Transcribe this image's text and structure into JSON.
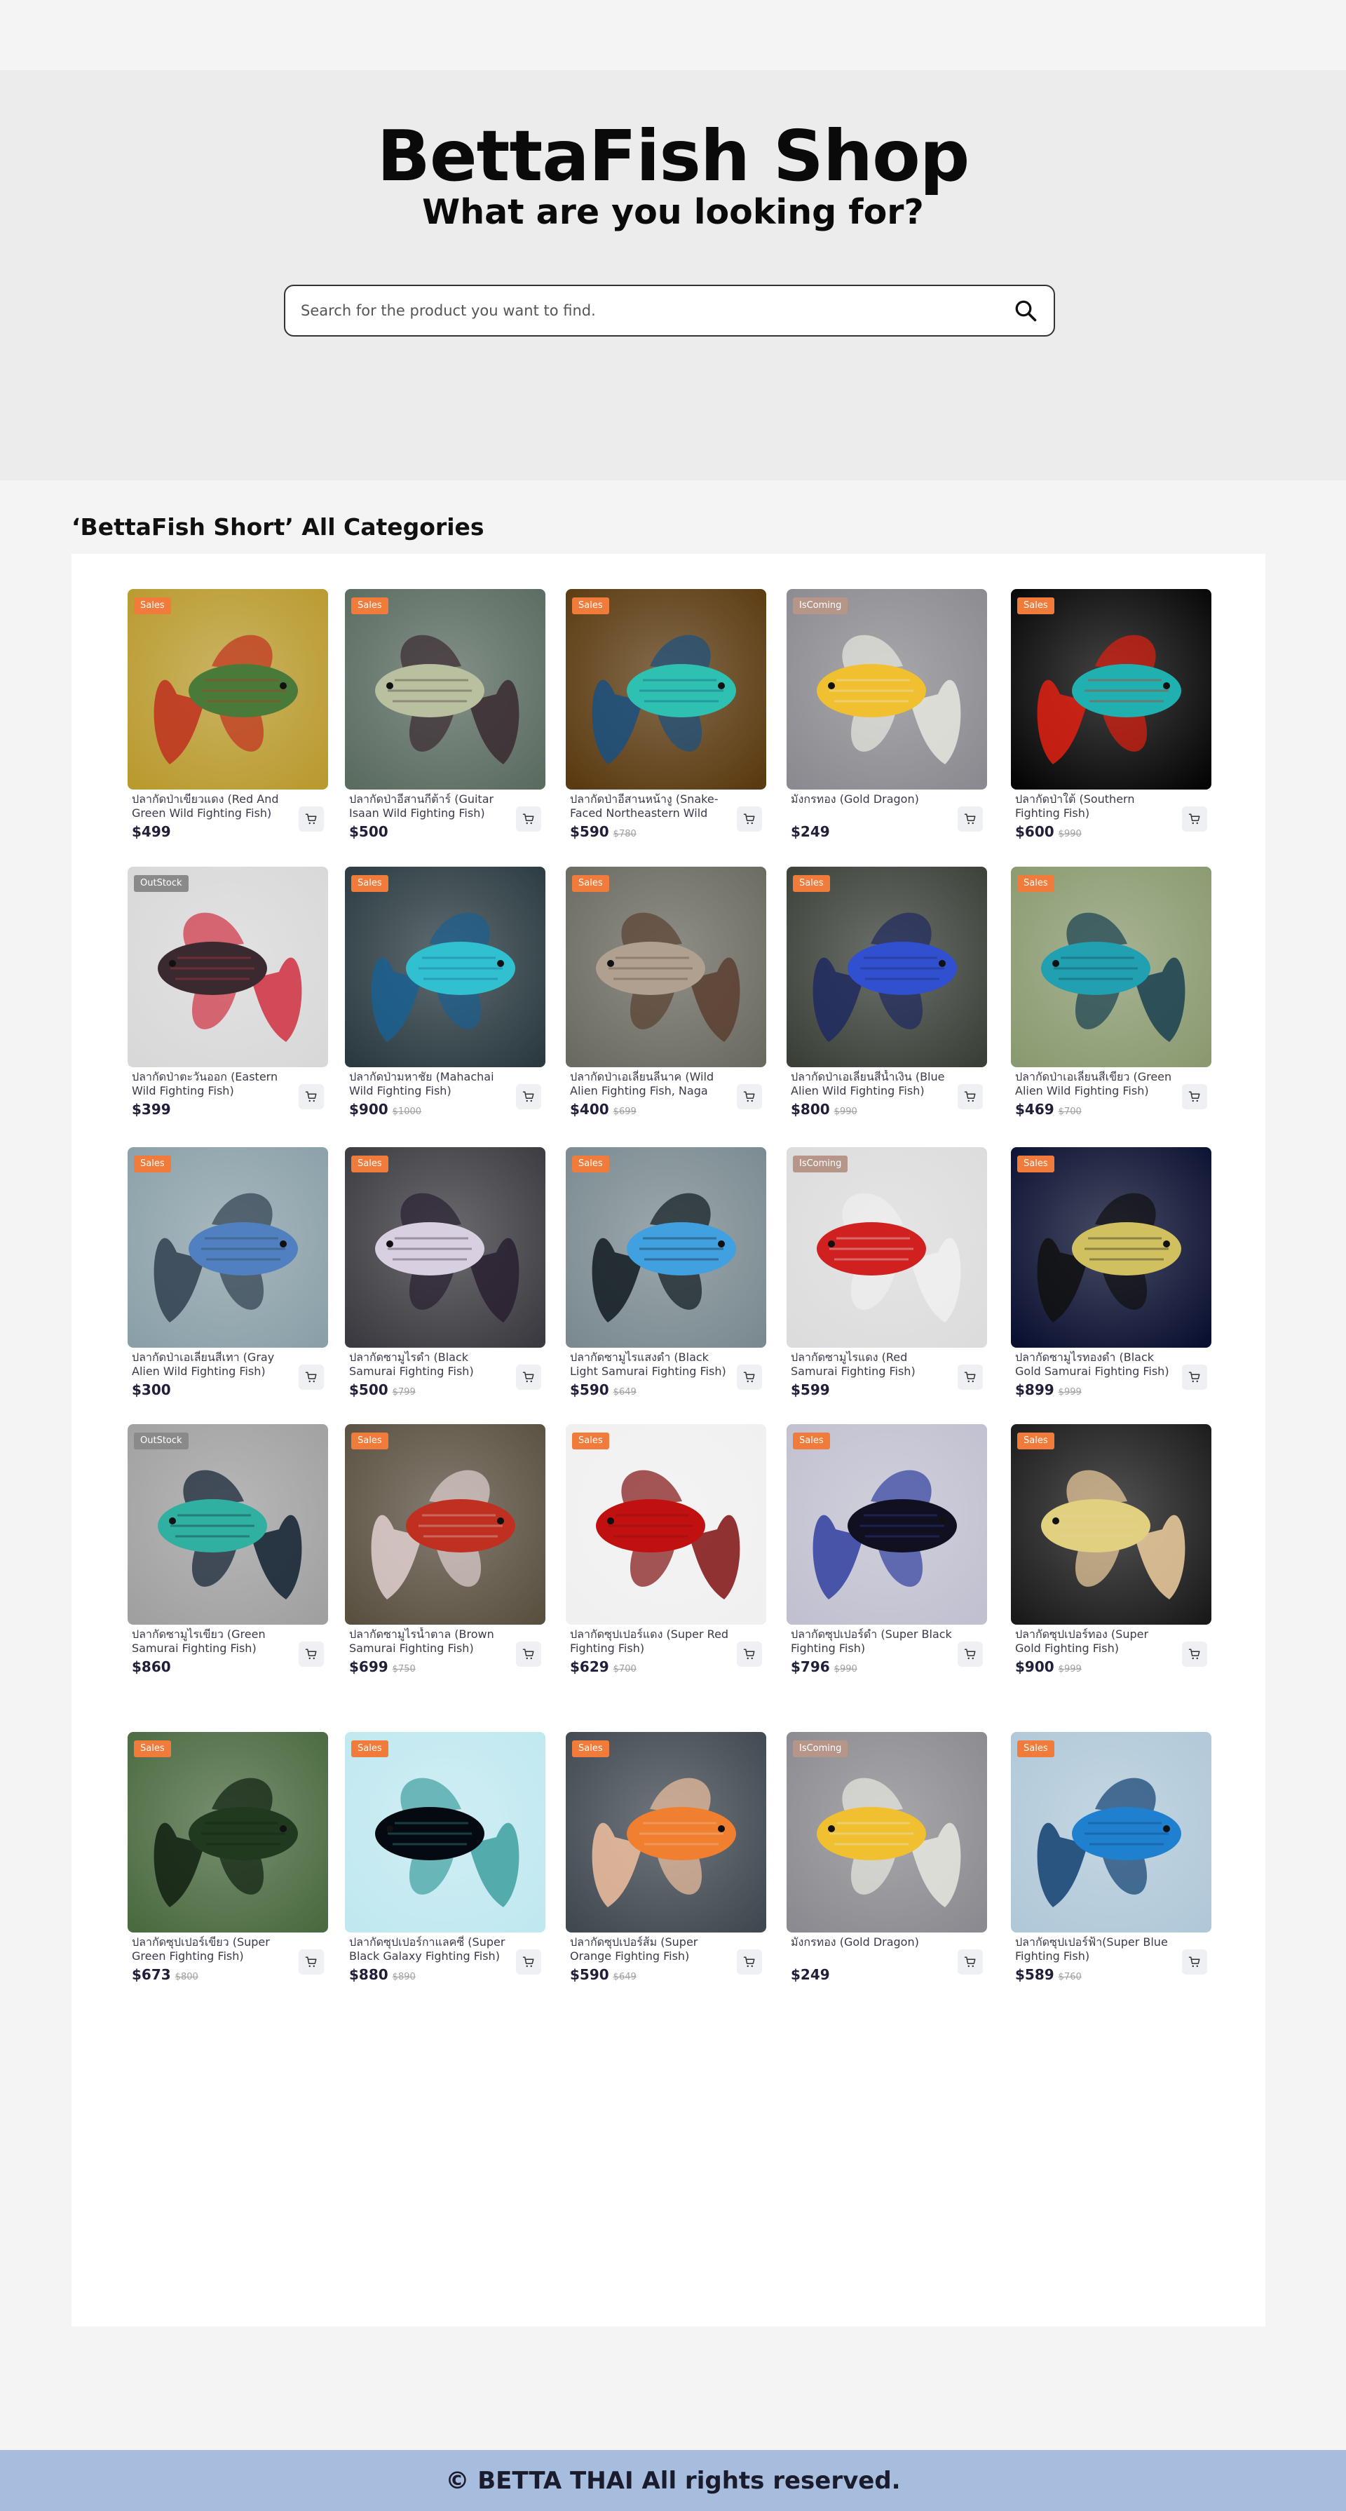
{
  "hero": {
    "title": "BettaFish Shop",
    "subtitle": "What are you looking for?",
    "search_placeholder": "Search for the product you want to find."
  },
  "section": {
    "title": "‘BettaFish Short’ All Categories"
  },
  "colors": {
    "sales": "#f07b3a",
    "incoming": "#b7968a",
    "outstock": "#8a8a8a",
    "footer": "#a7bddd"
  },
  "icons": {
    "search": "search-icon",
    "cart": "cart-icon"
  },
  "products": [
    {
      "name": "ปลากัดป่าเขียวแดง (Red And Green Wild Fighting Fish)",
      "price": "$499",
      "old": "",
      "badge": "Sales",
      "palette": [
        "#b99a2e",
        "#4a7a3a",
        "#c03020"
      ]
    },
    {
      "name": "ปลากัดป่าอีสานกีต้าร์ (Guitar Isaan Wild Fighting Fish)",
      "price": "$500",
      "old": "",
      "badge": "Sales",
      "palette": [
        "#5a6b60",
        "#b8c0a0",
        "#3a2a30"
      ]
    },
    {
      "name": "ปลากัดป่าอีสานหน้างู (Snake-Faced Northeastern Wild Fighting Fish)",
      "price": "$590",
      "old": "$780",
      "badge": "Sales",
      "palette": [
        "#5a3a10",
        "#2ec0b0",
        "#1a5080"
      ]
    },
    {
      "name": "มังกรทอง (Gold Dragon)",
      "price": "$249",
      "old": "",
      "badge": "IsComing",
      "palette": [
        "#8a8a90",
        "#f0c030",
        "#e8e8e0"
      ]
    },
    {
      "name": "ปลากัดป่าใต้ (Southern Fighting Fish)",
      "price": "$600",
      "old": "$990",
      "badge": "Sales",
      "palette": [
        "#050505",
        "#20b0b0",
        "#e02010"
      ]
    },
    {
      "name": "ปลากัดป่าตะวันออก (Eastern Wild Fighting Fish)",
      "price": "$399",
      "old": "",
      "badge": "OutStock",
      "palette": [
        "#d8d8d8",
        "#3a2a30",
        "#d03040"
      ]
    },
    {
      "name": "ปลากัดป่ามหาชัย (Mahachai Wild Fighting Fish)",
      "price": "$900",
      "old": "$1000",
      "badge": "Sales",
      "palette": [
        "#2a3a40",
        "#30c0d0",
        "#1a6090"
      ]
    },
    {
      "name": "ปลากัดป่าเอเลี่ยนลีนาค (Wild Alien Fighting Fish, Naga Color)",
      "price": "$400",
      "old": "$699",
      "badge": "Sales",
      "palette": [
        "#6a6a60",
        "#b0a090",
        "#5a4030"
      ]
    },
    {
      "name": "ปลากัดป่าเอเลี่ยนสีน้ำเงิน (Blue Alien Wild Fighting Fish)",
      "price": "$800",
      "old": "$990",
      "badge": "Sales",
      "palette": [
        "#3a4038",
        "#3050d0",
        "#202a60"
      ]
    },
    {
      "name": "ปลากัดป่าเอเลี่ยนสีเขียว (Green Alien Wild Fighting Fish)",
      "price": "$469",
      "old": "$700",
      "badge": "Sales",
      "palette": [
        "#8a9a70",
        "#20a0b0",
        "#1a4050"
      ]
    },
    {
      "name": "ปลากัดป่าเอเลี่ยนสีเทา (Gray Alien Wild Fighting Fish)",
      "price": "$300",
      "old": "",
      "badge": "Sales",
      "palette": [
        "#8aa0a8",
        "#5080c0",
        "#304050"
      ]
    },
    {
      "name": "ปลากัดซามูไรดำ (Black Samurai Fighting Fish)",
      "price": "$500",
      "old": "$799",
      "badge": "Sales",
      "palette": [
        "#3a3a40",
        "#d8d0e0",
        "#2a2030"
      ]
    },
    {
      "name": "ปลากัดซามูไรแสงดำ (Black Light Samurai Fighting Fish)",
      "price": "$590",
      "old": "$649",
      "badge": "Sales",
      "palette": [
        "#7a8a90",
        "#40a0e0",
        "#101a20"
      ]
    },
    {
      "name": "ปลากัดซามูไรแดง (Red Samurai Fighting Fish)",
      "price": "$599",
      "old": "",
      "badge": "IsComing",
      "palette": [
        "#dcdcdc",
        "#d02020",
        "#f0f0f0"
      ]
    },
    {
      "name": "ปลากัดซามูไรทองดำ (Black Gold Samurai Fighting Fish)",
      "price": "$899",
      "old": "$999",
      "badge": "Sales",
      "palette": [
        "#0a1030",
        "#d0c060",
        "#101010"
      ]
    },
    {
      "name": "ปลากัดซามูไรเขียว (Green Samurai Fighting Fish)",
      "price": "$860",
      "old": "",
      "badge": "OutStock",
      "palette": [
        "#a0a0a0",
        "#30b0a0",
        "#102030"
      ]
    },
    {
      "name": "ปลากัดซามูไรน้ำตาล (Brown Samurai Fighting Fish)",
      "price": "$699",
      "old": "$750",
      "badge": "Sales",
      "palette": [
        "#5a5040",
        "#c03020",
        "#e0d0d0"
      ]
    },
    {
      "name": "ปลากัดซุปเปอร์แดง (Super Red Fighting Fish)",
      "price": "$629",
      "old": "$700",
      "badge": "Sales",
      "palette": [
        "#f0f0f0",
        "#c01010",
        "#801010"
      ]
    },
    {
      "name": "ปลากัดซุปเปอร์ดำ (Super Black Fighting Fish)",
      "price": "$796",
      "old": "$990",
      "badge": "Sales",
      "palette": [
        "#c0c0d0",
        "#101020",
        "#3040a0"
      ]
    },
    {
      "name": "ปลากัดซุปเปอร์ทอง (Super Gold Fighting Fish)",
      "price": "$900",
      "old": "$999",
      "badge": "Sales",
      "palette": [
        "#1a1a1a",
        "#e0d080",
        "#f0d0a0"
      ]
    },
    {
      "name": "ปลากัดซุปเปอร์เขียว (Super Green Fighting Fish)",
      "price": "$673",
      "old": "$800",
      "badge": "Sales",
      "palette": [
        "#4a6a40",
        "#203a20",
        "#102010"
      ]
    },
    {
      "name": "ปลากัดซุปเปอร์กาแลคซี่ (Super Black Galaxy Fighting Fish)",
      "price": "$880",
      "old": "$890",
      "badge": "Sales",
      "palette": [
        "#c0e8f0",
        "#050a10",
        "#40a0a0"
      ]
    },
    {
      "name": "ปลากัดซุปเปอร์ส้ม (Super Orange Fighting Fish)",
      "price": "$590",
      "old": "$649",
      "badge": "Sales",
      "palette": [
        "#404850",
        "#f08030",
        "#f0c0a0"
      ]
    },
    {
      "name": "มังกรทอง (Gold Dragon)",
      "price": "$249",
      "old": "",
      "badge": "IsComing",
      "palette": [
        "#8a8a90",
        "#f0c030",
        "#e8e8e0"
      ]
    },
    {
      "name": "ปลากัดซุปเปอร์ฟ้า(Super Blue Fighting Fish)",
      "price": "$589",
      "old": "$760",
      "badge": "Sales",
      "palette": [
        "#b0c8d8",
        "#2080d0",
        "#104070"
      ]
    }
  ],
  "footer": {
    "text": "© BETTA THAI All rights reserved."
  }
}
